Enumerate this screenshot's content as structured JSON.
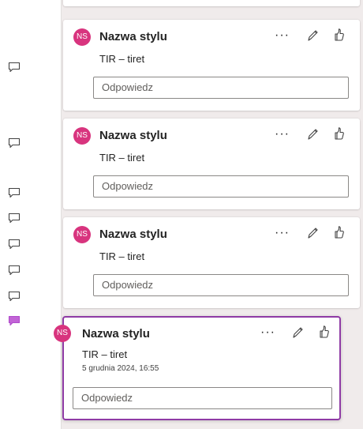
{
  "comments": [
    {
      "initials": "NS",
      "author": "Nazwa stylu",
      "text": "TIR – tiret",
      "more_label": "···",
      "reply_placeholder": "Odpowiedz"
    },
    {
      "initials": "NS",
      "author": "Nazwa stylu",
      "text": "TIR – tiret",
      "more_label": "···",
      "reply_placeholder": "Odpowiedz"
    },
    {
      "initials": "NS",
      "author": "Nazwa stylu",
      "text": "TIR – tiret",
      "more_label": "···",
      "reply_placeholder": "Odpowiedz"
    },
    {
      "initials": "NS",
      "author": "Nazwa stylu",
      "text": "TIR – tiret",
      "timestamp": "5 grudnia 2024, 16:55",
      "more_label": "···",
      "reply_placeholder": "Odpowiedz"
    }
  ],
  "colors": {
    "avatar": "#d8347e",
    "active_border": "#8f3ba5",
    "active_marker": "#c264d6",
    "pane": "#f0ebeb"
  },
  "icons": {
    "marker": "comment-icon",
    "edit": "pencil-icon",
    "like": "thumbs-up-icon",
    "more": "more-options-icon"
  }
}
